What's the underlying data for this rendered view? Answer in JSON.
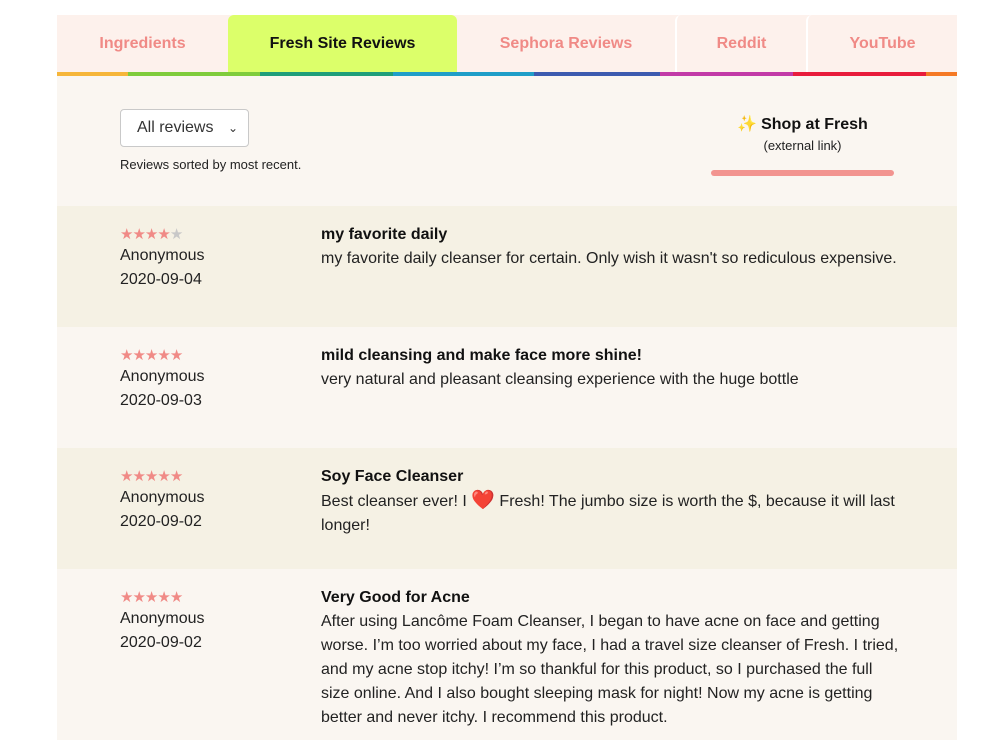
{
  "tabs": [
    {
      "label": "Ingredients",
      "active": false
    },
    {
      "label": "Fresh Site Reviews",
      "active": true
    },
    {
      "label": "Sephora Reviews",
      "active": false
    },
    {
      "label": "Reddit",
      "active": false
    },
    {
      "label": "YouTube",
      "active": false
    }
  ],
  "rainbow_colors": [
    "#f6b63a",
    "#7fcc3c",
    "#1f9e7a",
    "#1f9ec8",
    "#3c5bb0",
    "#c23aa8",
    "#e81c3c",
    "#f57a25"
  ],
  "controls": {
    "filter_value": "All reviews",
    "sort_note": "Reviews sorted by most recent.",
    "shop_icon": "✨",
    "shop_label": "Shop at Fresh",
    "shop_sublabel": "(external link)"
  },
  "colors": {
    "accent_pink": "#f08a86",
    "active_tab": "#dcff6a",
    "row_alt": "#f5f1e4",
    "row_plain": "#faf6f1"
  },
  "reviews": [
    {
      "rating": 4,
      "author": "Anonymous",
      "date": "2020-09-04",
      "title": "my favorite daily",
      "text": "my favorite daily cleanser for certain. Only wish it wasn't so rediculous expensive."
    },
    {
      "rating": 5,
      "author": "Anonymous",
      "date": "2020-09-03",
      "title": "mild cleansing and make face more shine!",
      "text": "very natural and pleasant cleansing experience with the huge bottle"
    },
    {
      "rating": 5,
      "author": "Anonymous",
      "date": "2020-09-02",
      "title": "Soy Face Cleanser",
      "text_before": "Best cleanser ever! I",
      "heart": "❤️",
      "text_after": "Fresh! The jumbo size is worth the $, because it will last longer!"
    },
    {
      "rating": 5,
      "author": "Anonymous",
      "date": "2020-09-02",
      "title": "Very Good for Acne",
      "text": "After using Lancôme Foam Cleanser, I began to have acne on face and getting worse. I’m too worried about my face, I had a travel size cleanser of Fresh. I tried, and my acne stop itchy! I’m so thankful for this product, so I purchased the full size online. And I also bought sleeping mask for night! Now my acne is getting better and never itchy. I recommend this product."
    }
  ]
}
